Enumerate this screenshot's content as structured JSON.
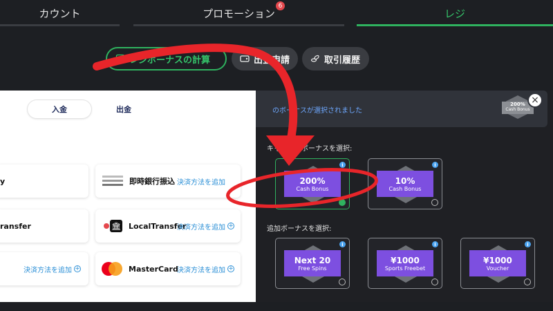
{
  "tabs": [
    {
      "label": "カウント"
    },
    {
      "label": "プロモーション",
      "badge": "6"
    },
    {
      "label": "レジ"
    }
  ],
  "actions": {
    "calc_label": "レジボーナスの計算",
    "withdraw_label": "出金申請",
    "history_label": "取引履歴"
  },
  "toggle": {
    "deposit": "入金",
    "withdraw": "出金"
  },
  "methods": [
    {
      "name": "y",
      "add": ""
    },
    {
      "name": "即時銀行振込",
      "add": "決済方法を追加"
    },
    {
      "name": "ransfer",
      "add": ""
    },
    {
      "name": "LocalTransfer",
      "add": "決済方法を追加"
    },
    {
      "name": "",
      "add": "決済方法を追加"
    },
    {
      "name": "MasterCard",
      "add": "決済方法を追加"
    }
  ],
  "right": {
    "banner_text": "のボーナスが選択されました",
    "banner_badge": {
      "big": "200%",
      "small": "Cash Bonus"
    },
    "cashback_label": "キャッシュボーナスを選択:",
    "extra_label": "追加ボーナスを選択:",
    "cash_bonuses": [
      {
        "big": "200%",
        "small": "Cash Bonus",
        "selected": true
      },
      {
        "big": "10%",
        "small": "Cash Bonus",
        "selected": false
      }
    ],
    "extra_bonuses": [
      {
        "big": "Next 20",
        "small": "Free Spins"
      },
      {
        "big": "¥1000",
        "small": "Sports Freebet"
      },
      {
        "big": "¥1000",
        "small": "Voucher"
      }
    ],
    "close_symbol": "×"
  },
  "colors": {
    "accent": "#2fb35f",
    "link": "#2b8fd6",
    "bonus_purple": "#7d4fe0",
    "annotation_red": "#e8252a"
  },
  "icons": [
    "calculator-icon",
    "wallet-icon",
    "coins-icon",
    "info-icon",
    "plus-circle-icon",
    "bank-icon",
    "mastercard-icon",
    "close-icon",
    "curved-arrow-annotation",
    "ellipse-annotation"
  ]
}
